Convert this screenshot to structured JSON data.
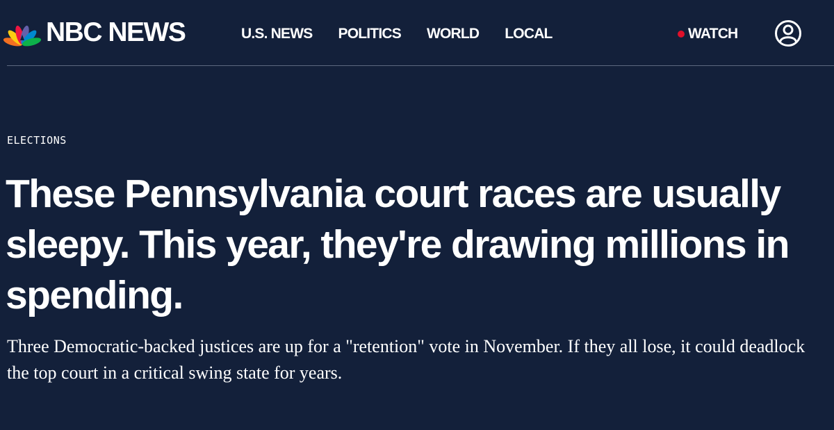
{
  "header": {
    "logo": {
      "text": "NBC NEWS",
      "icon": "peacock-icon",
      "peacock_colors": [
        "#fccc12",
        "#ef1541",
        "#6460aa",
        "#0089d0",
        "#0db14b",
        "#f37021"
      ]
    },
    "nav": {
      "items": [
        {
          "label": "U.S. NEWS"
        },
        {
          "label": "POLITICS"
        },
        {
          "label": "WORLD"
        },
        {
          "label": "LOCAL"
        }
      ]
    },
    "watch": {
      "label": "WATCH",
      "live_dot_color": "#e0102a"
    },
    "account": {
      "icon": "user-account-icon"
    }
  },
  "article": {
    "section": "ELECTIONS",
    "headline": "These Pennsylvania court races are usually sleepy. This year, they're drawing millions in spending.",
    "dek": "Three Democratic-backed justices are up for a \"retention\" vote in November. If they all lose, it could deadlock the top court in a critical swing state for years."
  },
  "colors": {
    "background": "#13203a",
    "text": "#ffffff",
    "divider": "#5d6880"
  }
}
